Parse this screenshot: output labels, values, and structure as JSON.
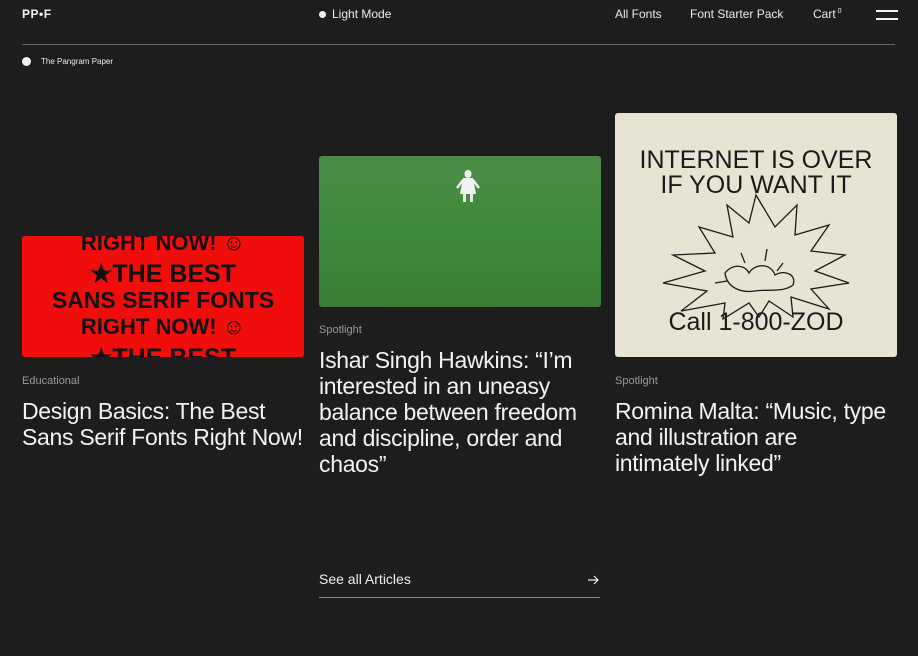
{
  "header": {
    "logo": "PP•F",
    "mode_label": "Light Mode",
    "nav": {
      "all_fonts": "All Fonts",
      "starter_pack": "Font Starter Pack",
      "cart": "Cart",
      "cart_count": "0"
    },
    "menu_icon": "hamburger-icon"
  },
  "breadcrumb": {
    "label": "The Pangram Paper"
  },
  "articles": [
    {
      "category": "Educational",
      "title": "Design Basics: The Best Sans Serif Fonts Right Now!",
      "image_lines": [
        "RIGHT NOW! ☺",
        "★THE BEST",
        "SANS SERIF FONTS",
        "RIGHT NOW! ☺",
        "★THE BEST"
      ],
      "image_bg": "#f20d0d"
    },
    {
      "category": "Spotlight",
      "title": "Ishar Singh Hawkins: “I’m interested in an uneasy balance between freedom and discipline, order and chaos”",
      "image_bg": "#3d8a3a"
    },
    {
      "category": "Spotlight",
      "title": "Romina Malta: “Music, type and illustration are intimately linked”",
      "image_lines": [
        "INTERNET IS OVER",
        "IF YOU WANT IT",
        "Call 1-800-ZOD"
      ],
      "image_bg": "#e8e4d4"
    }
  ],
  "see_all": {
    "label": "See all Articles",
    "icon": "arrow-right-icon"
  }
}
